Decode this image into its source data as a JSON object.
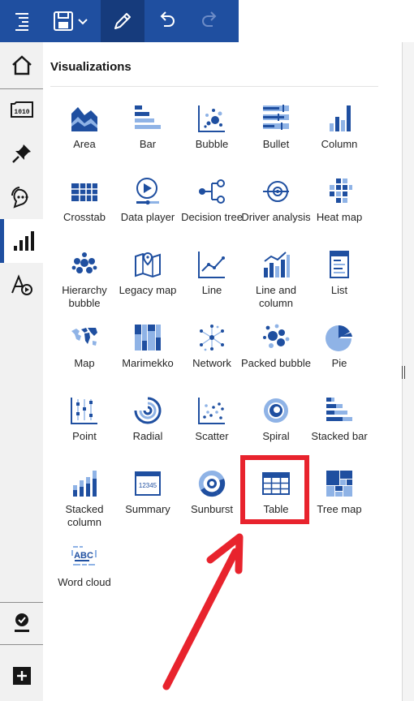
{
  "panel": {
    "title": "Visualizations"
  },
  "visualizations": [
    {
      "key": "area",
      "label": "Area"
    },
    {
      "key": "bar",
      "label": "Bar"
    },
    {
      "key": "bubble",
      "label": "Bubble"
    },
    {
      "key": "bullet",
      "label": "Bullet"
    },
    {
      "key": "column",
      "label": "Column"
    },
    {
      "key": "crosstab",
      "label": "Crosstab"
    },
    {
      "key": "data-player",
      "label": "Data player"
    },
    {
      "key": "decision-tree",
      "label": "Decision tree"
    },
    {
      "key": "driver-analysis",
      "label": "Driver analysis"
    },
    {
      "key": "heat-map",
      "label": "Heat map"
    },
    {
      "key": "hierarchy-bubble",
      "label": "Hierarchy bubble"
    },
    {
      "key": "legacy-map",
      "label": "Legacy map"
    },
    {
      "key": "line",
      "label": "Line"
    },
    {
      "key": "line-and-column",
      "label": "Line and column"
    },
    {
      "key": "list",
      "label": "List"
    },
    {
      "key": "map",
      "label": "Map"
    },
    {
      "key": "marimekko",
      "label": "Marimekko"
    },
    {
      "key": "network",
      "label": "Network"
    },
    {
      "key": "packed-bubble",
      "label": "Packed bubble"
    },
    {
      "key": "pie",
      "label": "Pie"
    },
    {
      "key": "point",
      "label": "Point"
    },
    {
      "key": "radial",
      "label": "Radial"
    },
    {
      "key": "scatter",
      "label": "Scatter"
    },
    {
      "key": "spiral",
      "label": "Spiral"
    },
    {
      "key": "stacked-bar",
      "label": "Stacked bar"
    },
    {
      "key": "stacked-column",
      "label": "Stacked column"
    },
    {
      "key": "summary",
      "label": "Summary",
      "icon_text": "12345"
    },
    {
      "key": "sunburst",
      "label": "Sunburst"
    },
    {
      "key": "table",
      "label": "Table"
    },
    {
      "key": "tree-map",
      "label": "Tree map"
    },
    {
      "key": "word-cloud",
      "label": "Word cloud",
      "icon_text": "ABC"
    }
  ],
  "colors": {
    "brand": "#1f4fa0",
    "icon_dark": "#1f4fa0",
    "icon_light": "#8fb3e6",
    "annotation": "#e8232d",
    "rail_bg": "#f1f1f1"
  },
  "toolbar_icons": [
    "menu-icon",
    "save-icon",
    "edit-pencil-icon",
    "undo-icon",
    "redo-icon"
  ],
  "rail_icons": [
    "home-icon",
    "data-sources-icon",
    "pin-icon",
    "conversation-icon",
    "visualizations-icon",
    "text-style-icon",
    "assistant-icon",
    "add-icon"
  ]
}
